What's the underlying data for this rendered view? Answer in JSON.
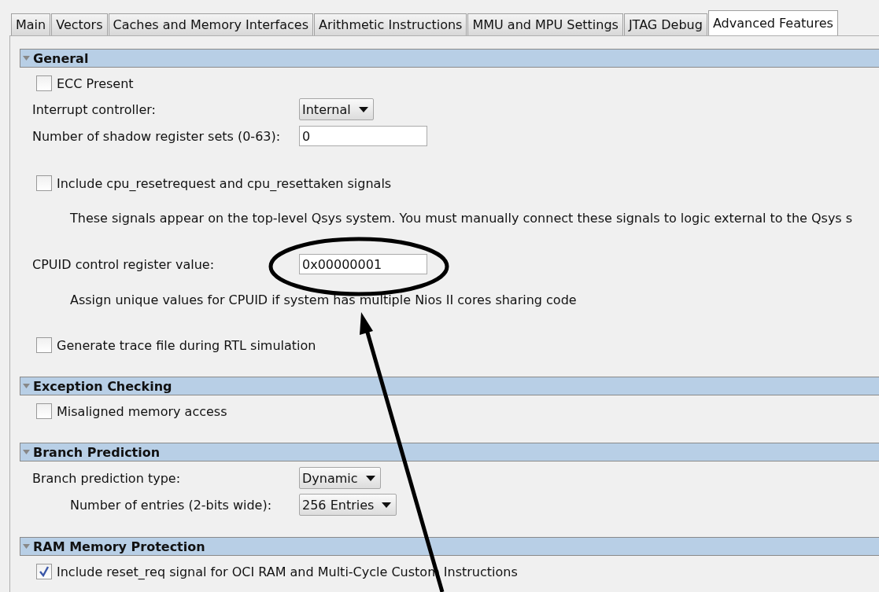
{
  "tabs": [
    {
      "label": "Main",
      "selected": false
    },
    {
      "label": "Vectors",
      "selected": false
    },
    {
      "label": "Caches and Memory Interfaces",
      "selected": false
    },
    {
      "label": "Arithmetic Instructions",
      "selected": false
    },
    {
      "label": "MMU and MPU Settings",
      "selected": false
    },
    {
      "label": "JTAG Debug",
      "selected": false
    },
    {
      "label": "Advanced Features",
      "selected": true
    }
  ],
  "sections": [
    {
      "title": "General",
      "expanded": true,
      "rows": [
        {
          "kind": "checkbox",
          "label": "ECC Present",
          "checked": false
        },
        {
          "kind": "dropdown",
          "label": "Interrupt controller:",
          "value": "Internal"
        },
        {
          "kind": "text_field",
          "label": "Number of shadow register sets (0-63):",
          "value": "0"
        },
        {
          "kind": "checkbox",
          "label": "Include cpu_resetrequest and cpu_resettaken signals",
          "checked": false
        },
        {
          "kind": "note",
          "text": "These signals appear on the top-level Qsys system. You must manually connect these signals to logic external to the Qsys s"
        },
        {
          "kind": "text_field",
          "label": "CPUID control register value:",
          "value": "0x00000001"
        },
        {
          "kind": "note",
          "text": "Assign unique values for CPUID if system has multiple Nios II cores sharing code"
        },
        {
          "kind": "checkbox",
          "label": "Generate trace file during RTL simulation",
          "checked": false
        }
      ]
    },
    {
      "title": "Exception Checking",
      "expanded": true,
      "rows": [
        {
          "kind": "checkbox",
          "label": "Misaligned memory access",
          "checked": false
        }
      ]
    },
    {
      "title": "Branch Prediction",
      "expanded": true,
      "rows": [
        {
          "kind": "dropdown",
          "label": "Branch prediction type:",
          "value": "Dynamic",
          "children": [
            {
              "kind": "dropdown",
              "label": "Number of entries (2-bits wide):",
              "value": "256 Entries"
            }
          ]
        }
      ]
    },
    {
      "title": "RAM Memory Protection",
      "expanded": true,
      "rows": [
        {
          "kind": "checkbox",
          "label": "Include reset_req signal for OCI RAM and Multi-Cycle Custom Instructions",
          "checked": true
        }
      ]
    }
  ]
}
